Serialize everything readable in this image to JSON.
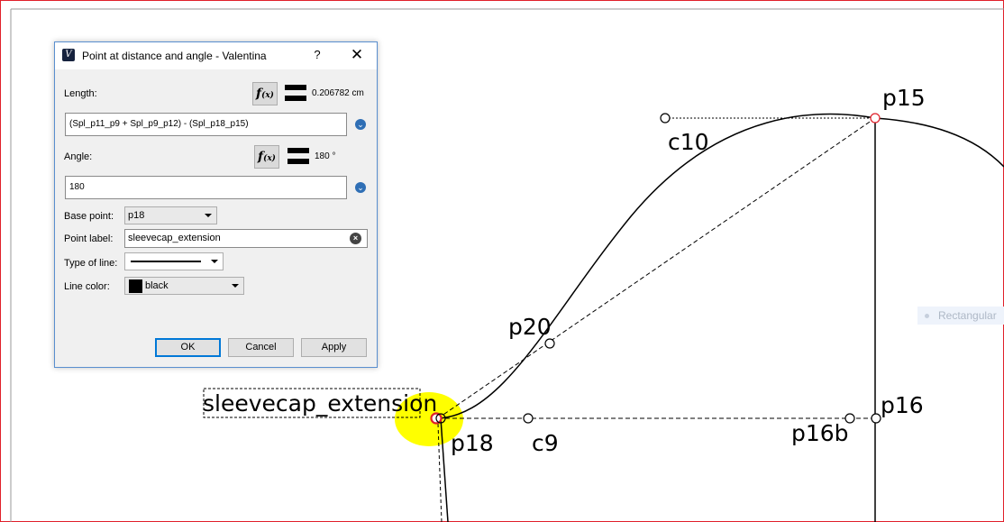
{
  "drawing": {
    "point_labels": {
      "p15": "p15",
      "c10": "c10",
      "p20": "p20",
      "sleevecap_extension": "sleevecap_extension",
      "p16": "p16",
      "p16b": "p16b",
      "p18": "p18",
      "c9": "c9"
    },
    "ghost_item": "Rectangular",
    "colors": {
      "line": "#000000",
      "selected_point": "#e0202a",
      "highlight": "#ffff00",
      "canvas_border": "#e0202a"
    }
  },
  "dialog": {
    "title": "Point at distance and angle - Valentina",
    "help": "?",
    "close": "✕",
    "app_icon": "V",
    "length_label": "Length:",
    "length_formula": "(Spl_p11_p9 + Spl_p9_p12) - (Spl_p18_p15)",
    "length_result": "0.206782 cm",
    "angle_label": "Angle:",
    "angle_formula": "180",
    "angle_result": "180 °",
    "fx_text": "f",
    "fx_sub": "(x)",
    "base_point_label": "Base point:",
    "base_point_value": "p18",
    "point_label_label": "Point label:",
    "point_label_value": "sleevecap_extension",
    "type_of_line_label": "Type of line:",
    "line_color_label": "Line color:",
    "line_color_value": "black",
    "buttons": {
      "ok": "OK",
      "cancel": "Cancel",
      "apply": "Apply"
    }
  }
}
